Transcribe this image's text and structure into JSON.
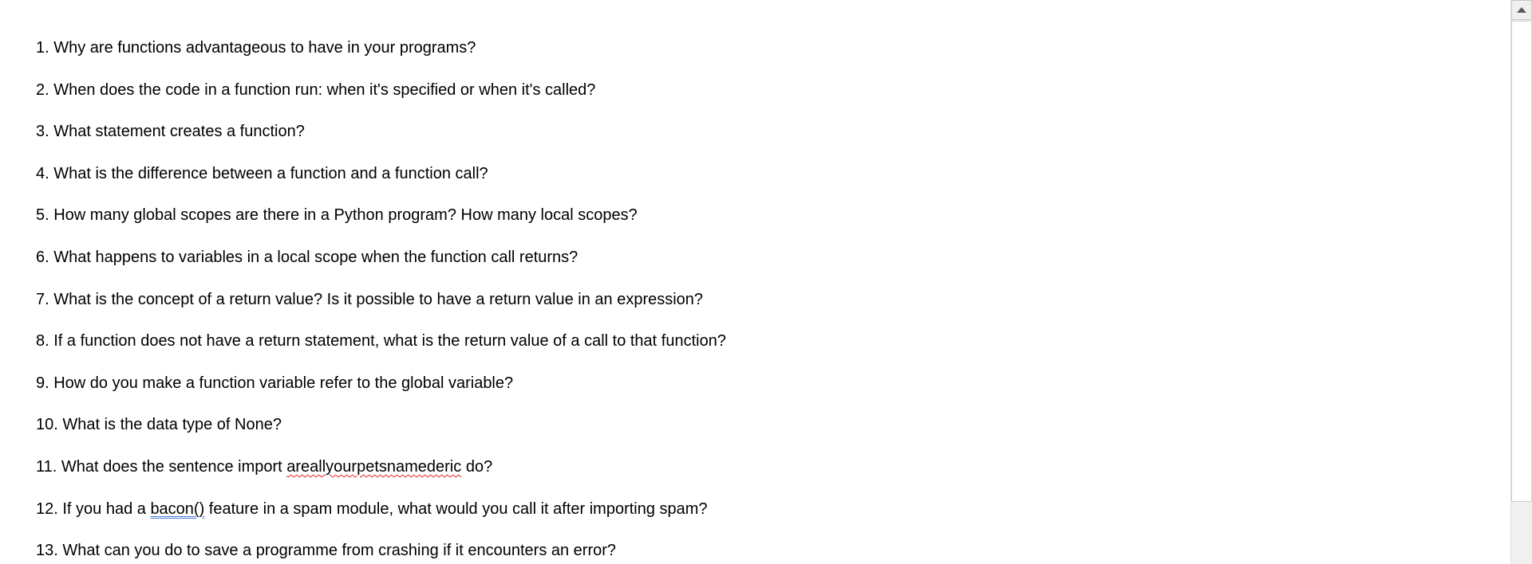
{
  "document": {
    "questions": [
      {
        "text": "1. Why are functions advantageous to have in your programs?"
      },
      {
        "text": "2. When does the code in a function run: when it's specified or when it's called?"
      },
      {
        "text": "3. What statement creates a function?"
      },
      {
        "text": "4. What is the difference between a function and a function call?"
      },
      {
        "text": "5. How many global scopes are there in a Python program? How many local scopes?"
      },
      {
        "text": "6. What happens to variables in a local scope when the function call returns?"
      },
      {
        "text": "7. What is the concept of a return value? Is it possible to have a return value in an expression?"
      },
      {
        "text": "8. If a function does not have a return statement, what is the return value of a call to that function?"
      },
      {
        "text": "9. How do you make a function variable refer to the global variable?"
      },
      {
        "text": "10. What is the data type of None?"
      },
      {
        "before": "11. What does the sentence import ",
        "flagged": "areallyourpetsnamederic",
        "after": " do?"
      },
      {
        "before": "12. If you had a ",
        "flagged": "bacon()",
        "after": " feature in a spam module, what would you call it after importing spam?"
      },
      {
        "text": "13. What can you do to save a programme from crashing if it encounters an error?"
      }
    ]
  },
  "scrollbar": {
    "up_icon": "triangle-up"
  }
}
